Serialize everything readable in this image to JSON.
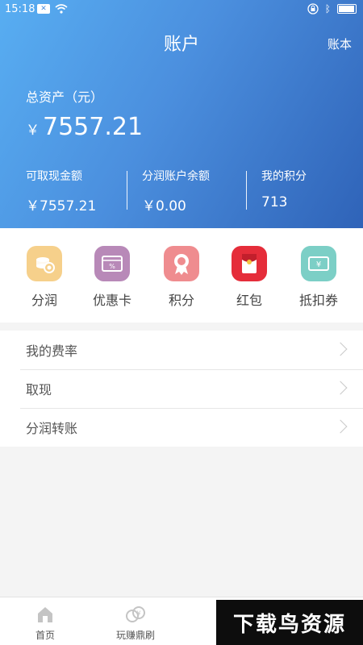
{
  "status_bar": {
    "time": "15:18"
  },
  "header": {
    "title": "账户",
    "ledger_label": "账本"
  },
  "summary": {
    "total_label": "总资产（元）",
    "currency": "￥",
    "total_value": "7557.21",
    "columns": [
      {
        "label": "可取现金额",
        "value": "￥7557.21"
      },
      {
        "label": "分润账户余额",
        "value": "￥0.00"
      },
      {
        "label": "我的积分",
        "value": "713"
      }
    ]
  },
  "quick_actions": [
    {
      "label": "分润",
      "icon": "coins-icon",
      "color": "#f6d08b"
    },
    {
      "label": "优惠卡",
      "icon": "coupon-card-icon",
      "color": "#b889b8"
    },
    {
      "label": "积分",
      "icon": "medal-icon",
      "color": "#ef8c8f"
    },
    {
      "label": "红包",
      "icon": "red-envelope-icon",
      "color": "#e52d3a"
    },
    {
      "label": "抵扣券",
      "icon": "yen-ticket-icon",
      "color": "#7ccfc6"
    }
  ],
  "menu": [
    {
      "label": "我的费率"
    },
    {
      "label": "取现"
    },
    {
      "label": "分润转账"
    }
  ],
  "tab_bar": [
    {
      "label": "首页",
      "icon": "home-icon"
    },
    {
      "label": "玩赚鼎刷",
      "icon": "coins-stack-icon"
    }
  ],
  "watermark": {
    "text": "下载鸟资源"
  }
}
